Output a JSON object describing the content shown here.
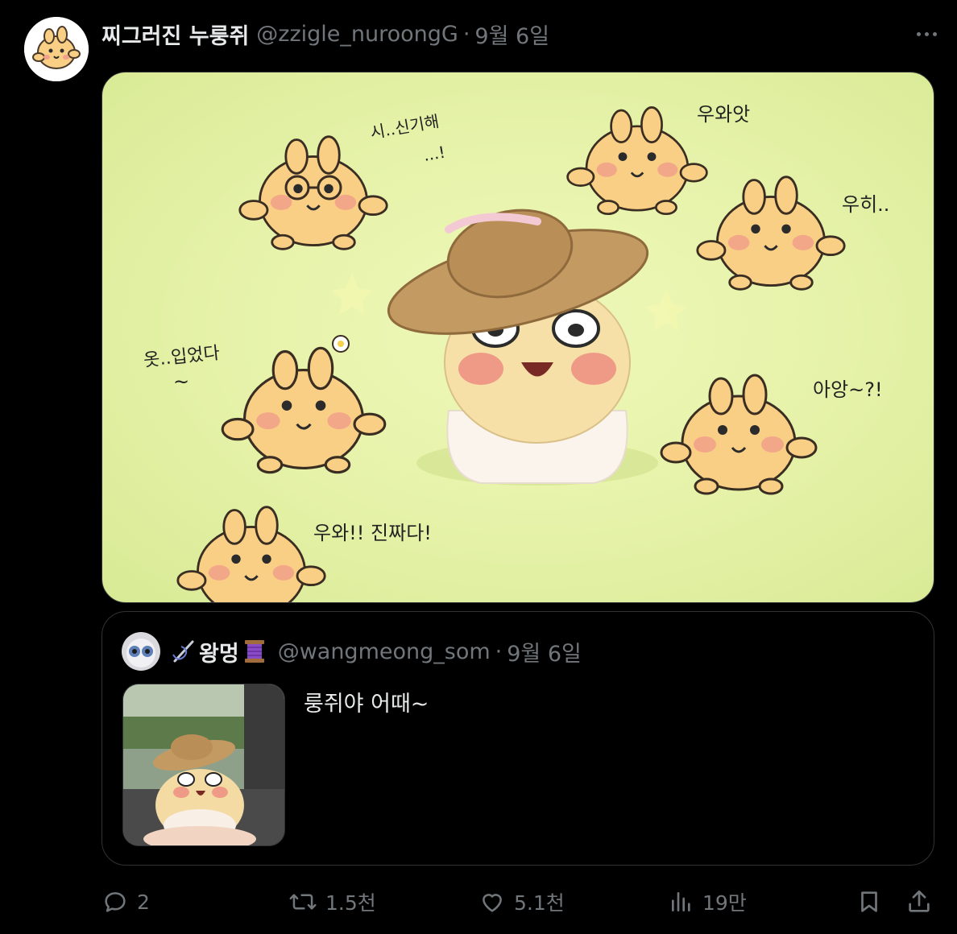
{
  "post": {
    "display_name": "찌그러진 누룽쥐",
    "handle": "@zzigle_nuroongG",
    "separator": "·",
    "time": "9월 6일",
    "media": {
      "speech": {
        "s1a": "시..신기해",
        "s1b": "...!",
        "s2": "우와앗",
        "s3": "우히..",
        "s4a": "옷..입었다",
        "s4b": "~",
        "s5": "아앙~?!",
        "s6": "우와!! 진짜다!"
      }
    }
  },
  "quote": {
    "display_name": "왕멍",
    "handle": "@wangmeong_som",
    "separator": "·",
    "time": "9월 6일",
    "text": "룽쥐야 어때~"
  },
  "actions": {
    "reply_count": "2",
    "repost_count": "1.5천",
    "like_count": "5.1천",
    "view_count": "19만"
  },
  "colors": {
    "background": "#000000",
    "text_primary": "#e7e9ea",
    "text_secondary": "#71767b",
    "border": "#2f3336",
    "media_bg": "#e7f3ab",
    "character": "#f9cf86",
    "blush": "#f2a08a"
  },
  "icons": [
    "more-icon",
    "reply-icon",
    "repost-icon",
    "like-icon",
    "views-icon",
    "bookmark-icon",
    "share-icon",
    "needle-icon",
    "thread-spool-icon"
  ]
}
